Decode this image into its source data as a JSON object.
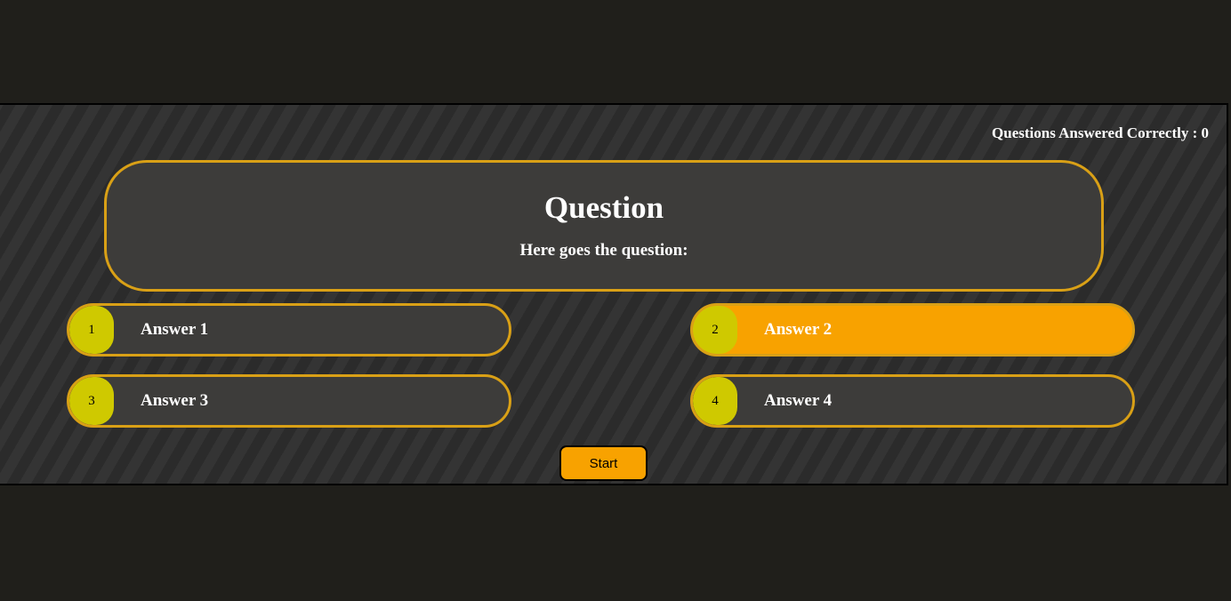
{
  "score": {
    "text": "Questions Answered Correctly : 0"
  },
  "question": {
    "title": "Question",
    "text": "Here goes the question:"
  },
  "answers": [
    {
      "number": "1",
      "label": "Answer 1",
      "selected": false
    },
    {
      "number": "2",
      "label": "Answer 2",
      "selected": true
    },
    {
      "number": "3",
      "label": "Answer 3",
      "selected": false
    },
    {
      "number": "4",
      "label": "Answer 4",
      "selected": false
    }
  ],
  "controls": {
    "start_label": "Start"
  },
  "colors": {
    "page_bg": "#201f1b",
    "card_bg": "#3d3c3a",
    "border_accent": "#d9a016",
    "selected_answer": "#f8a200",
    "number_badge": "#cfc900",
    "start_button": "#f8a200"
  }
}
